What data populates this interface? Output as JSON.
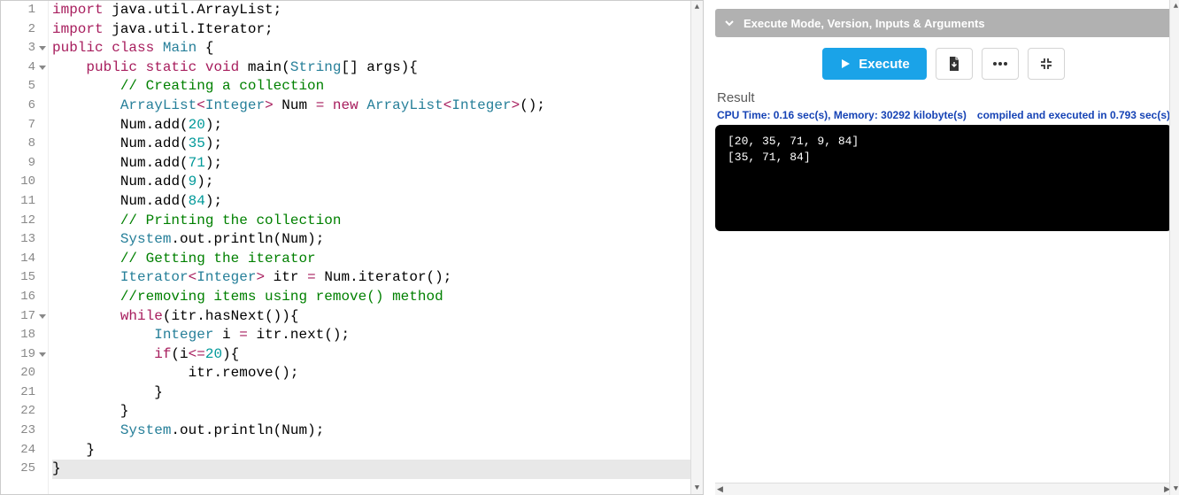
{
  "editor": {
    "fold_lines": [
      3,
      4,
      17,
      19
    ],
    "active_line": 25,
    "lines": [
      {
        "n": 1,
        "tokens": [
          [
            "kw",
            "import"
          ],
          [
            "sp",
            " "
          ],
          [
            "pkg",
            "java.util.ArrayList"
          ],
          [
            "pun",
            ";"
          ]
        ]
      },
      {
        "n": 2,
        "tokens": [
          [
            "kw",
            "import"
          ],
          [
            "sp",
            " "
          ],
          [
            "pkg",
            "java.util.Iterator"
          ],
          [
            "pun",
            ";"
          ]
        ]
      },
      {
        "n": 3,
        "tokens": [
          [
            "kw",
            "public"
          ],
          [
            "sp",
            " "
          ],
          [
            "kw",
            "class"
          ],
          [
            "sp",
            " "
          ],
          [
            "type",
            "Main"
          ],
          [
            "sp",
            " "
          ],
          [
            "pun",
            "{"
          ]
        ]
      },
      {
        "n": 4,
        "tokens": [
          [
            "sp",
            "    "
          ],
          [
            "kw",
            "public"
          ],
          [
            "sp",
            " "
          ],
          [
            "kw",
            "static"
          ],
          [
            "sp",
            " "
          ],
          [
            "kw",
            "void"
          ],
          [
            "sp",
            " "
          ],
          [
            "id",
            "main"
          ],
          [
            "pun",
            "("
          ],
          [
            "type",
            "String"
          ],
          [
            "pun",
            "[] "
          ],
          [
            "id",
            "args"
          ],
          [
            "pun",
            "){"
          ]
        ]
      },
      {
        "n": 5,
        "tokens": [
          [
            "sp",
            "        "
          ],
          [
            "comment",
            "// Creating a collection"
          ]
        ]
      },
      {
        "n": 6,
        "tokens": [
          [
            "sp",
            "        "
          ],
          [
            "type",
            "ArrayList"
          ],
          [
            "op",
            "<"
          ],
          [
            "gen",
            "Integer"
          ],
          [
            "op",
            ">"
          ],
          [
            "sp",
            " "
          ],
          [
            "id",
            "Num"
          ],
          [
            "sp",
            " "
          ],
          [
            "op",
            "="
          ],
          [
            "sp",
            " "
          ],
          [
            "new",
            "new"
          ],
          [
            "sp",
            " "
          ],
          [
            "type",
            "ArrayList"
          ],
          [
            "op",
            "<"
          ],
          [
            "gen",
            "Integer"
          ],
          [
            "op",
            ">"
          ],
          [
            "pun",
            "();"
          ]
        ]
      },
      {
        "n": 7,
        "tokens": [
          [
            "sp",
            "        "
          ],
          [
            "id",
            "Num"
          ],
          [
            "pun",
            "."
          ],
          [
            "id",
            "add"
          ],
          [
            "pun",
            "("
          ],
          [
            "num",
            "20"
          ],
          [
            "pun",
            ");"
          ]
        ]
      },
      {
        "n": 8,
        "tokens": [
          [
            "sp",
            "        "
          ],
          [
            "id",
            "Num"
          ],
          [
            "pun",
            "."
          ],
          [
            "id",
            "add"
          ],
          [
            "pun",
            "("
          ],
          [
            "num",
            "35"
          ],
          [
            "pun",
            ");"
          ]
        ]
      },
      {
        "n": 9,
        "tokens": [
          [
            "sp",
            "        "
          ],
          [
            "id",
            "Num"
          ],
          [
            "pun",
            "."
          ],
          [
            "id",
            "add"
          ],
          [
            "pun",
            "("
          ],
          [
            "num",
            "71"
          ],
          [
            "pun",
            ");"
          ]
        ]
      },
      {
        "n": 10,
        "tokens": [
          [
            "sp",
            "        "
          ],
          [
            "id",
            "Num"
          ],
          [
            "pun",
            "."
          ],
          [
            "id",
            "add"
          ],
          [
            "pun",
            "("
          ],
          [
            "num",
            "9"
          ],
          [
            "pun",
            ");"
          ]
        ]
      },
      {
        "n": 11,
        "tokens": [
          [
            "sp",
            "        "
          ],
          [
            "id",
            "Num"
          ],
          [
            "pun",
            "."
          ],
          [
            "id",
            "add"
          ],
          [
            "pun",
            "("
          ],
          [
            "num",
            "84"
          ],
          [
            "pun",
            ");"
          ]
        ]
      },
      {
        "n": 12,
        "tokens": [
          [
            "sp",
            "        "
          ],
          [
            "comment",
            "// Printing the collection"
          ]
        ]
      },
      {
        "n": 13,
        "tokens": [
          [
            "sp",
            "        "
          ],
          [
            "type",
            "System"
          ],
          [
            "pun",
            "."
          ],
          [
            "id",
            "out"
          ],
          [
            "pun",
            "."
          ],
          [
            "id",
            "println"
          ],
          [
            "pun",
            "("
          ],
          [
            "id",
            "Num"
          ],
          [
            "pun",
            ");"
          ]
        ]
      },
      {
        "n": 14,
        "tokens": [
          [
            "sp",
            "        "
          ],
          [
            "comment",
            "// Getting the iterator"
          ]
        ]
      },
      {
        "n": 15,
        "tokens": [
          [
            "sp",
            "        "
          ],
          [
            "type",
            "Iterator"
          ],
          [
            "op",
            "<"
          ],
          [
            "gen",
            "Integer"
          ],
          [
            "op",
            ">"
          ],
          [
            "sp",
            " "
          ],
          [
            "id",
            "itr"
          ],
          [
            "sp",
            " "
          ],
          [
            "op",
            "="
          ],
          [
            "sp",
            " "
          ],
          [
            "id",
            "Num"
          ],
          [
            "pun",
            "."
          ],
          [
            "id",
            "iterator"
          ],
          [
            "pun",
            "();"
          ]
        ]
      },
      {
        "n": 16,
        "tokens": [
          [
            "sp",
            "        "
          ],
          [
            "comment",
            "//removing items using remove() method"
          ]
        ]
      },
      {
        "n": 17,
        "tokens": [
          [
            "sp",
            "        "
          ],
          [
            "kw",
            "while"
          ],
          [
            "pun",
            "("
          ],
          [
            "id",
            "itr"
          ],
          [
            "pun",
            "."
          ],
          [
            "id",
            "hasNext"
          ],
          [
            "pun",
            "()){"
          ]
        ]
      },
      {
        "n": 18,
        "tokens": [
          [
            "sp",
            "            "
          ],
          [
            "type",
            "Integer"
          ],
          [
            "sp",
            " "
          ],
          [
            "id",
            "i"
          ],
          [
            "sp",
            " "
          ],
          [
            "op",
            "="
          ],
          [
            "sp",
            " "
          ],
          [
            "id",
            "itr"
          ],
          [
            "pun",
            "."
          ],
          [
            "id",
            "next"
          ],
          [
            "pun",
            "();"
          ]
        ]
      },
      {
        "n": 19,
        "tokens": [
          [
            "sp",
            "            "
          ],
          [
            "kw",
            "if"
          ],
          [
            "pun",
            "("
          ],
          [
            "id",
            "i"
          ],
          [
            "op",
            "<="
          ],
          [
            "num",
            "20"
          ],
          [
            "pun",
            "){"
          ]
        ]
      },
      {
        "n": 20,
        "tokens": [
          [
            "sp",
            "                "
          ],
          [
            "id",
            "itr"
          ],
          [
            "pun",
            "."
          ],
          [
            "id",
            "remove"
          ],
          [
            "pun",
            "();"
          ]
        ]
      },
      {
        "n": 21,
        "tokens": [
          [
            "sp",
            "            "
          ],
          [
            "pun",
            "}"
          ]
        ]
      },
      {
        "n": 22,
        "tokens": [
          [
            "sp",
            "        "
          ],
          [
            "pun",
            "}"
          ]
        ]
      },
      {
        "n": 23,
        "tokens": [
          [
            "sp",
            "        "
          ],
          [
            "type",
            "System"
          ],
          [
            "pun",
            "."
          ],
          [
            "id",
            "out"
          ],
          [
            "pun",
            "."
          ],
          [
            "id",
            "println"
          ],
          [
            "pun",
            "("
          ],
          [
            "id",
            "Num"
          ],
          [
            "pun",
            ");"
          ]
        ]
      },
      {
        "n": 24,
        "tokens": [
          [
            "sp",
            "    "
          ],
          [
            "pun",
            "}"
          ]
        ]
      },
      {
        "n": 25,
        "tokens": [
          [
            "pun",
            "}"
          ]
        ]
      }
    ]
  },
  "output": {
    "collapse_label": "Execute Mode, Version, Inputs & Arguments",
    "execute_label": "Execute",
    "result_label": "Result",
    "cpu_line": "CPU Time: 0.16 sec(s), Memory: 30292 kilobyte(s)",
    "compiled_line": "compiled and executed in 0.793 sec(s)",
    "console_lines": [
      "[20, 35, 71, 9, 84]",
      "[35, 71, 84]"
    ]
  }
}
